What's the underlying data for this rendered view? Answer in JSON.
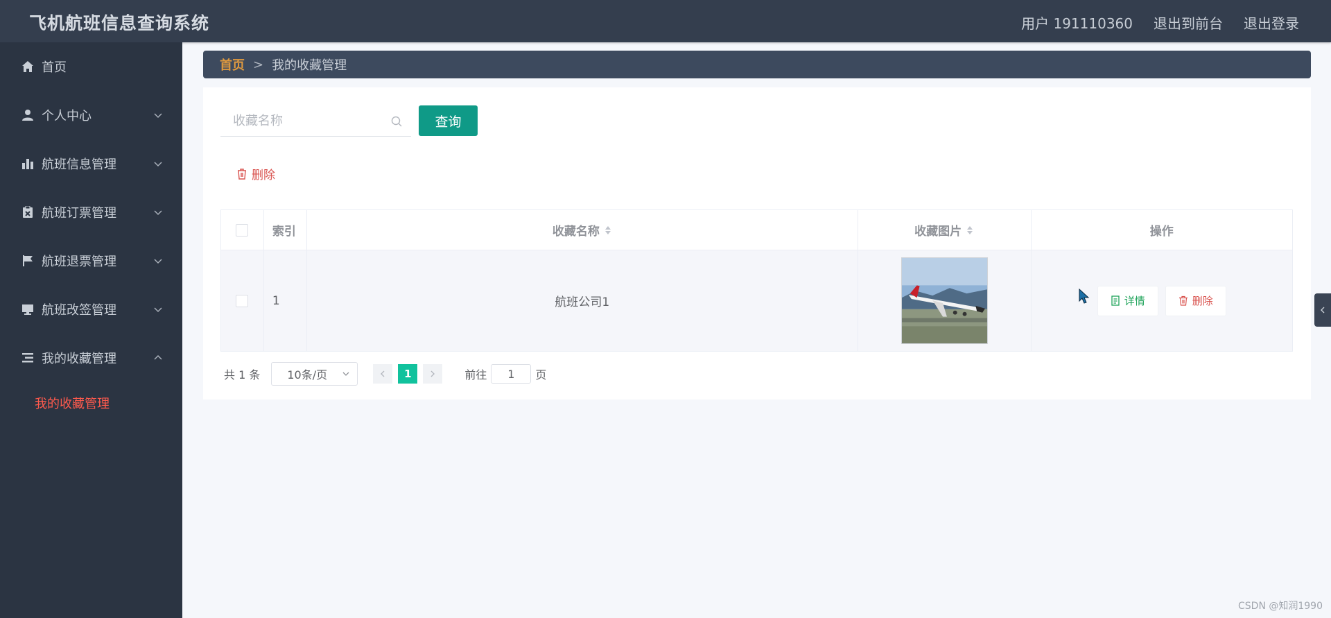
{
  "header": {
    "app_title": "飞机航班信息查询系统",
    "links": [
      "用户 191110360",
      "退出到前台",
      "退出登录"
    ]
  },
  "sidebar": {
    "items": [
      {
        "label": "首页",
        "icon": "home-icon"
      },
      {
        "label": "个人中心",
        "icon": "user-icon"
      },
      {
        "label": "航班信息管理",
        "icon": "bar-chart-icon"
      },
      {
        "label": "航班订票管理",
        "icon": "clipboard-icon"
      },
      {
        "label": "航班退票管理",
        "icon": "flag-icon"
      },
      {
        "label": "航班改签管理",
        "icon": "monitor-icon"
      },
      {
        "label": "我的收藏管理",
        "icon": "list-icon"
      }
    ],
    "active_sub": "我的收藏管理"
  },
  "breadcrumb": {
    "home": "首页",
    "separator": ">",
    "current": "我的收藏管理"
  },
  "search": {
    "placeholder": "收藏名称",
    "button": "查询"
  },
  "toolbar": {
    "delete_label": "删除"
  },
  "table": {
    "headers": {
      "index": "索引",
      "name": "收藏名称",
      "image": "收藏图片",
      "actions": "操作"
    },
    "rows": [
      {
        "index": "1",
        "name": "航班公司1",
        "detail": "详情",
        "delete": "删除"
      }
    ]
  },
  "pagination": {
    "total": "共 1 条",
    "page_size": "10条/页",
    "current_page": "1",
    "goto_prefix": "前往",
    "goto_value": "1",
    "goto_suffix": "页"
  },
  "watermark": "CSDN @知润1990",
  "colors": {
    "accent": "#0f9a87",
    "danger": "#d9534f",
    "active_menu": "#ff5a4d",
    "header_bg": "#343e4e",
    "sidebar_bg": "#2b3442"
  }
}
